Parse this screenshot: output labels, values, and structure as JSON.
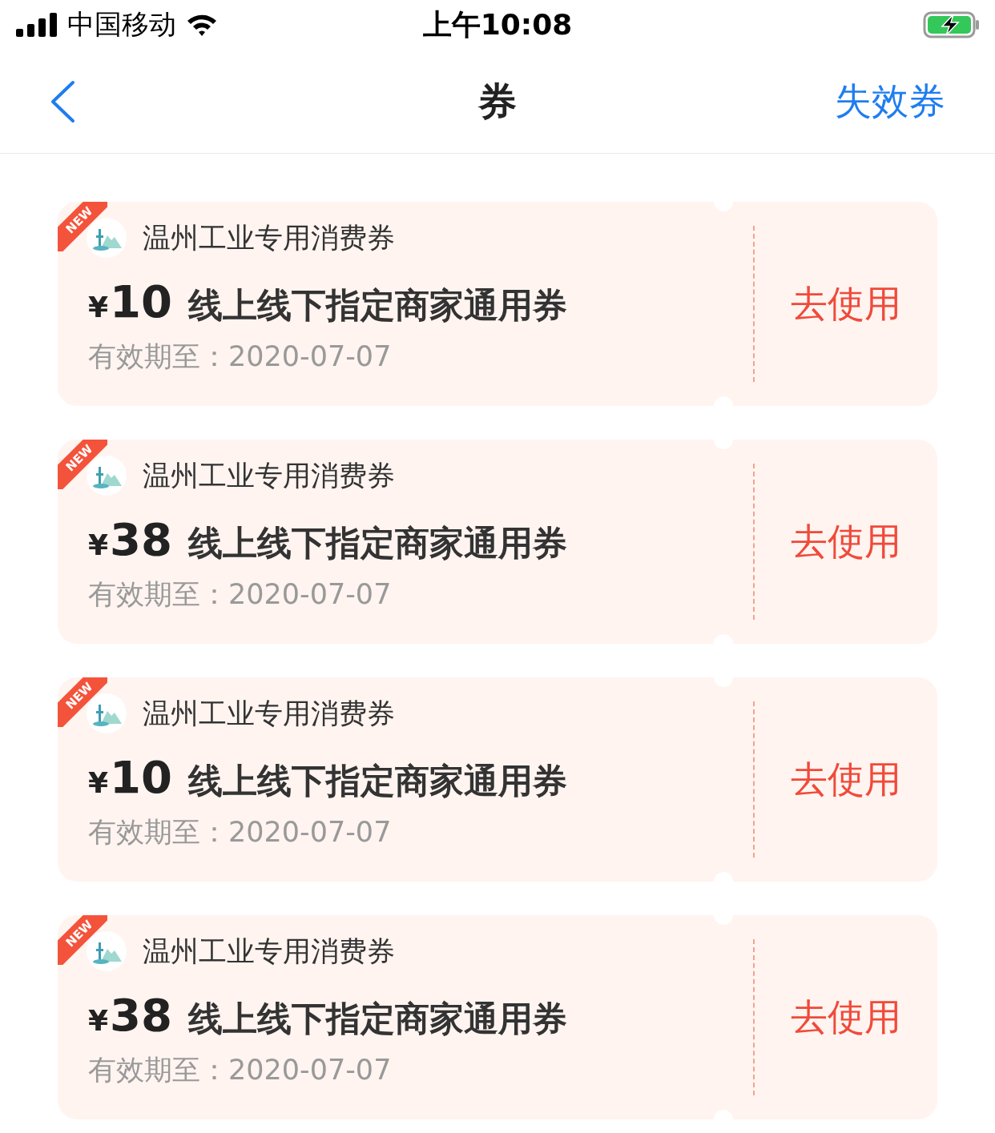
{
  "status_bar": {
    "carrier": "中国移动",
    "time": "上午10:08",
    "charging": true
  },
  "nav": {
    "title": "券",
    "action": "失效券"
  },
  "coupons": [
    {
      "badge": "NEW",
      "issuer": "温州工业专用消费券",
      "currency": "¥",
      "amount": "10",
      "name": "线上线下指定商家通用券",
      "expiry": "有效期至：2020-07-07",
      "button": "去使用"
    },
    {
      "badge": "NEW",
      "issuer": "温州工业专用消费券",
      "currency": "¥",
      "amount": "38",
      "name": "线上线下指定商家通用券",
      "expiry": "有效期至：2020-07-07",
      "button": "去使用"
    },
    {
      "badge": "NEW",
      "issuer": "温州工业专用消费券",
      "currency": "¥",
      "amount": "10",
      "name": "线上线下指定商家通用券",
      "expiry": "有效期至：2020-07-07",
      "button": "去使用"
    },
    {
      "badge": "NEW",
      "issuer": "温州工业专用消费券",
      "currency": "¥",
      "amount": "38",
      "name": "线上线下指定商家通用券",
      "expiry": "有效期至：2020-07-07",
      "button": "去使用"
    }
  ]
}
